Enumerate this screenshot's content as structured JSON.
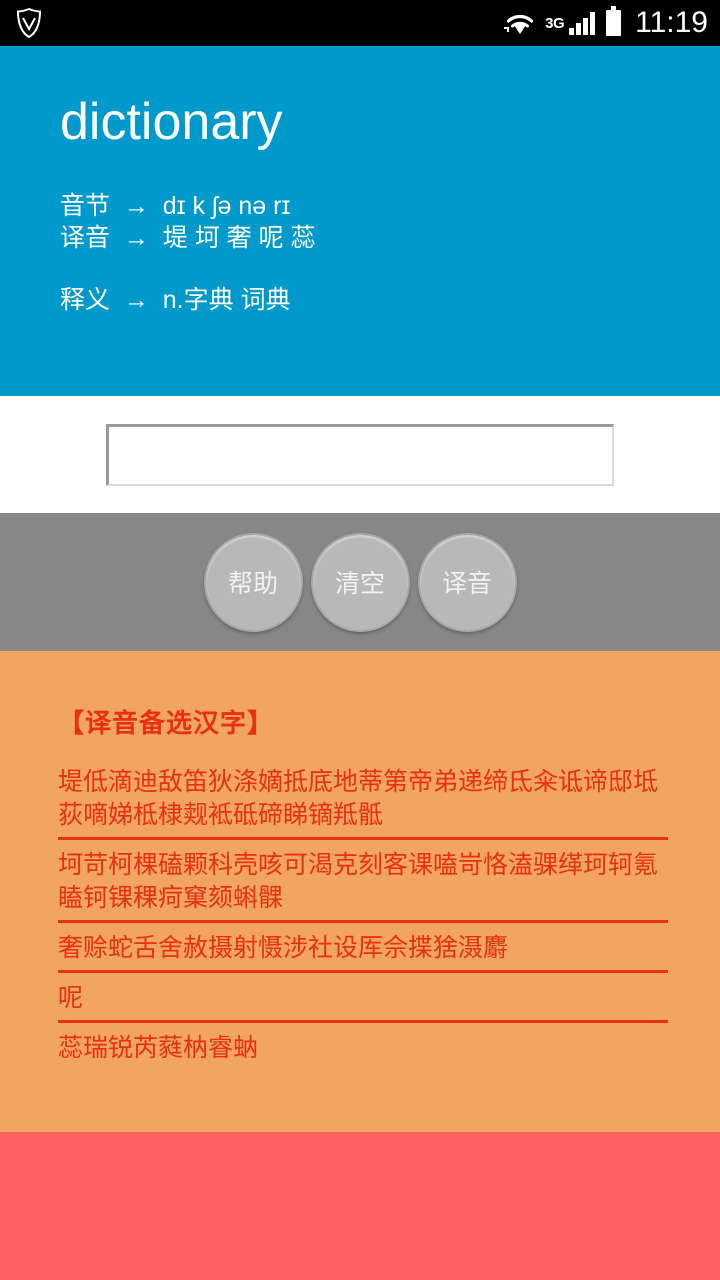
{
  "statusbar": {
    "shield_icon": "shield-icon",
    "wifi_icon": "wifi-icon",
    "network_type": "3G",
    "signal_icon": "signal-bars-icon",
    "battery_icon": "battery-icon",
    "time": "11:19"
  },
  "header": {
    "title": "dictionary",
    "syllable_line": "音节  →  dɪ k ʃə nə rɪ",
    "transliteration_line": "译音  →  堤 坷 奢 呢 蕊",
    "definition_line": "释义  →  n.字典 词典",
    "background_color": "#0099cc"
  },
  "input": {
    "value": "",
    "placeholder": ""
  },
  "buttons": [
    {
      "label": "帮助",
      "name": "help-button"
    },
    {
      "label": "清空",
      "name": "clear-button"
    },
    {
      "label": "译音",
      "name": "transliterate-button"
    }
  ],
  "candidates": {
    "title": "【译音备选汉字】",
    "text_color": "#e8310f",
    "background_color": "#f2a461",
    "rows": [
      "堤低滴迪敌笛狄涤嫡抵底地蒂第帝弟递缔氐籴诋谛邸坻荻嘀娣柢棣觌袛砥碲睇镝羝骶",
      "坷苛柯棵磕颗科壳咳可渴克刻客课嗑岢恪溘骒缂珂轲氪瞌钶锞稞疴窠颏蝌髁",
      "奢赊蛇舌舍赦摄射慑涉社设厍佘揲猞滠麝",
      "呢",
      "蕊瑞锐芮蕤枘睿蚋"
    ]
  },
  "bottom_panel": {
    "background_color": "#ff6161"
  }
}
